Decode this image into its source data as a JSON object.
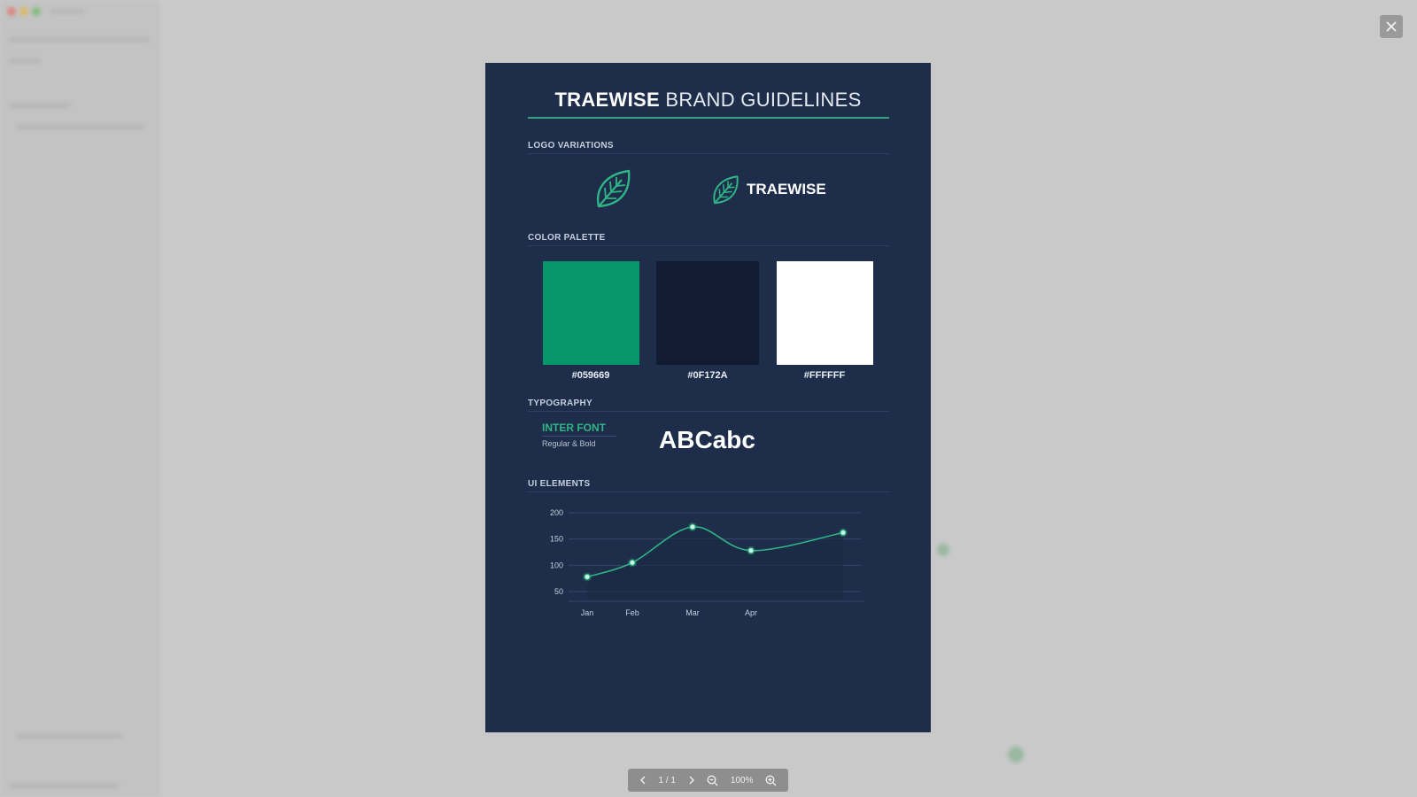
{
  "document": {
    "title_brand": "TRAEWISE",
    "title_rest": "BRAND GUIDELINES",
    "sections": {
      "logo": "LOGO VARIATIONS",
      "palette": "COLOR PALETTE",
      "typography": "TYPOGRAPHY",
      "ui": "UI ELEMENTS"
    },
    "logo_wordmark": "TRAEWISE",
    "swatches": [
      {
        "hex": "#059669",
        "label": "#059669"
      },
      {
        "hex": "#0F172A",
        "label": "#0F172A"
      },
      {
        "hex": "#FFFFFF",
        "label": "#FFFFFF"
      }
    ],
    "typography": {
      "font_name": "INTER FONT",
      "weights": "Regular & Bold",
      "sample": "ABCabc"
    }
  },
  "chart_data": {
    "type": "line",
    "categories": [
      "Jan",
      "Feb",
      "Mar",
      "Apr",
      ""
    ],
    "x_tick_labels": [
      "Jan",
      "Feb",
      "Mar",
      "Apr"
    ],
    "values": [
      78,
      105,
      173,
      128,
      162
    ],
    "y_ticks": [
      50,
      100,
      150,
      200
    ],
    "ylim": [
      35,
      210
    ],
    "grid": true,
    "line_color": "#2fb586"
  },
  "pager": {
    "page": "1 / 1",
    "zoom": "100%"
  },
  "colors": {
    "accent": "#2fa384",
    "doc_background": "#1d2d4a",
    "backdrop": "#c8c8c8"
  },
  "icons": {
    "leaf": "leaf-icon",
    "close": "close-icon",
    "prev": "chevron-left-icon",
    "next": "chevron-right-icon",
    "zoom_out": "zoom-out-icon",
    "zoom_in": "zoom-in-icon"
  }
}
